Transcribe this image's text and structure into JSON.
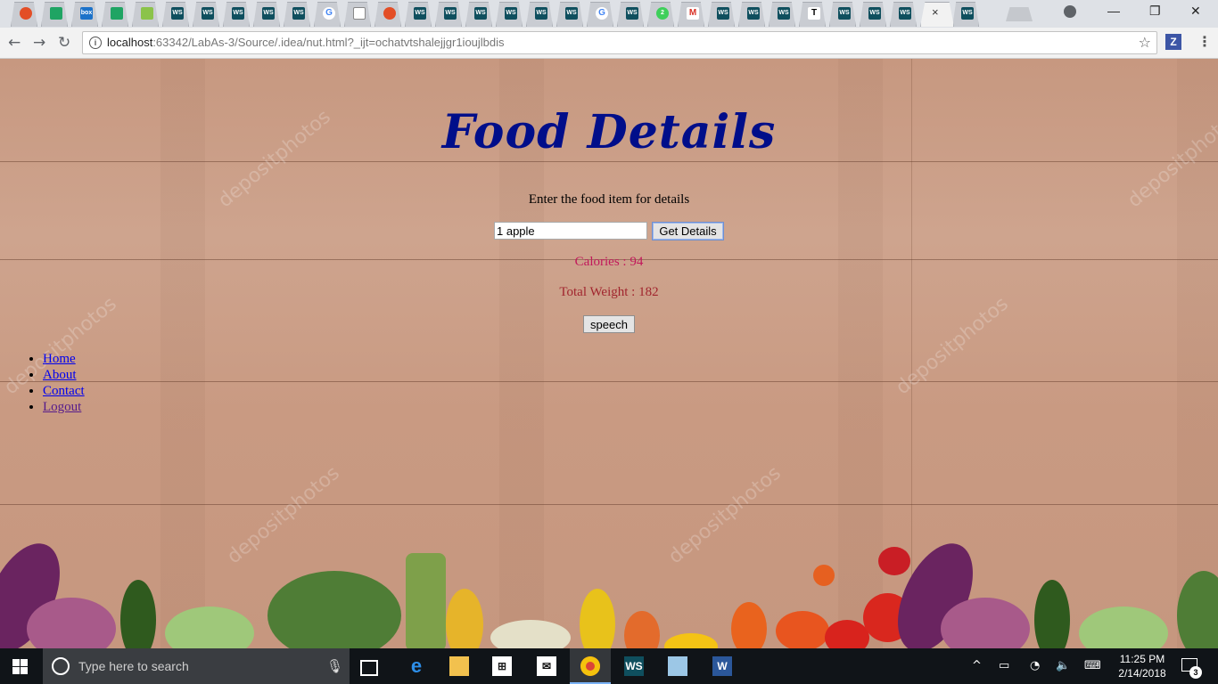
{
  "browser": {
    "url_host": "localhost",
    "url_rest": ":63342/LabAs-3/Source/.idea/nut.html?_ijt=ochatvtshalejjgr1ioujlbdis",
    "tab_icons": [
      "red-circle",
      "sheet",
      "box",
      "sheet",
      "lime",
      "ws",
      "ws",
      "ws",
      "ws",
      "ws",
      "google",
      "doc",
      "red",
      "ws",
      "ws",
      "ws",
      "ws",
      "ws",
      "ws",
      "google",
      "ws",
      "green",
      "gmail",
      "ws",
      "ws",
      "ws",
      "t",
      "ws",
      "ws",
      "ws",
      "active",
      "ws"
    ],
    "ws_label": "WS",
    "box_label": "box",
    "google_label": "G",
    "gmail_label": "M",
    "t_label": "T",
    "green_label": "2",
    "close_symbol": "×",
    "extension_label": "Z"
  },
  "page": {
    "title": "Food Details",
    "prompt": "Enter the food item for details",
    "input_value": "1 apple",
    "get_details_label": "Get Details",
    "calories": "Calories : 94",
    "total_weight": "Total Weight : 182",
    "speech_label": "speech",
    "watermark": "depositphotos",
    "nav": [
      "Home",
      "About",
      "Contact",
      "Logout"
    ]
  },
  "taskbar": {
    "search_placeholder": "Type here to search",
    "time": "11:25 PM",
    "date": "2/14/2018",
    "notification_count": "3"
  },
  "colors": {
    "title": "#000e8a",
    "calories": "#c2185b",
    "weight": "#a1252e",
    "link": "#0000ee",
    "visited_link": "#551a8b"
  }
}
